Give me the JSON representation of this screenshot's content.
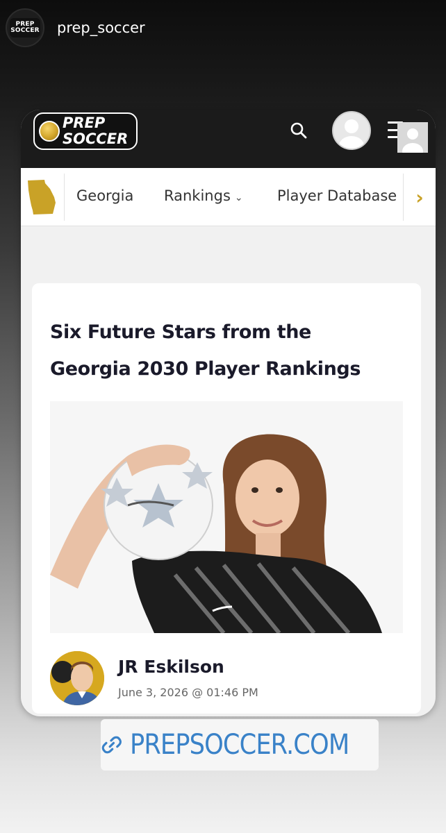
{
  "story": {
    "username": "prep_soccer",
    "avatar_logo": {
      "line1": "PREP",
      "line2": "SOCCER"
    }
  },
  "site": {
    "brand": {
      "line1": "PREP",
      "line2": "SOCCER"
    },
    "icons": {
      "search": "search-icon",
      "user": "user-avatar-icon",
      "menu": "hamburger-menu-icon",
      "next": "chevron-right-icon",
      "state": "georgia-state-icon"
    },
    "nav": {
      "items": [
        {
          "label": "Georgia"
        },
        {
          "label": "Rankings",
          "dropdown": "⌄"
        },
        {
          "label": "Player Database"
        }
      ],
      "next": "›"
    }
  },
  "article": {
    "title_line1": "Six Future Stars from the",
    "title_line2": "Georgia 2030 Player Rankings",
    "author": "JR Eskilson",
    "date": "June 3, 2026 @ 01:46 PM"
  },
  "link_sticker": {
    "label": "PREPSOCCER.COM",
    "icon": "link-icon"
  },
  "colors": {
    "accent_gold": "#c9a227",
    "link_blue": "#3a82c8",
    "header_dark": "#1b1b1b"
  }
}
